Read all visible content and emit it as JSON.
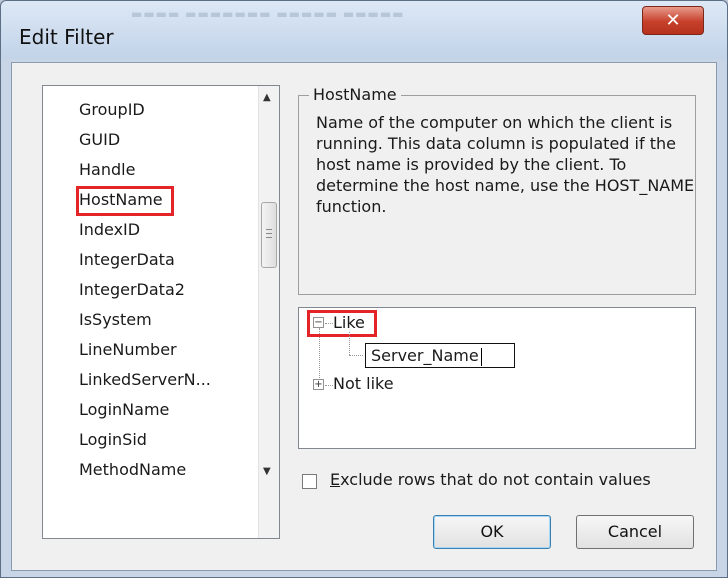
{
  "window": {
    "title": "Edit Filter",
    "close_glyph": "✕"
  },
  "columns": [
    "GroupID",
    "GUID",
    "Handle",
    "HostName",
    "IndexID",
    "IntegerData",
    "IntegerData2",
    "IsSystem",
    "LineNumber",
    "LinkedServerN...",
    "LoginName",
    "LoginSid",
    "MethodName"
  ],
  "selected_column": "HostName",
  "description": {
    "title": "HostName",
    "text": "Name of the computer on which the client is running. This data column is populated if the host name is provided by the client. To determine the host name, use the HOST_NAME function."
  },
  "tree": {
    "like": {
      "label": "Like",
      "expander": "−",
      "value": "Server_Name"
    },
    "not_like": {
      "label": "Not like",
      "expander": "+"
    }
  },
  "exclude_option": {
    "mnemonic": "E",
    "label_rest": "xclude rows that do not contain values",
    "checked": false
  },
  "buttons": {
    "ok": "OK",
    "cancel": "Cancel"
  },
  "icons": {
    "scroll_up": "▲",
    "scroll_down": "▼"
  }
}
